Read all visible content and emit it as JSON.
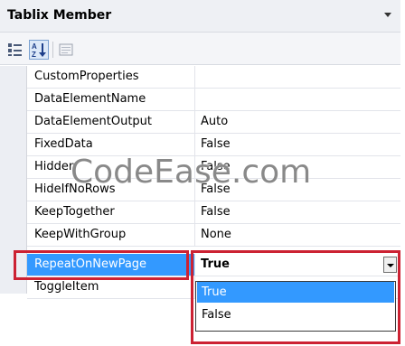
{
  "header": {
    "title": "Tablix Member"
  },
  "toolbar": {
    "buttons": [
      {
        "icon": "categorized-icon"
      },
      {
        "icon": "alphabetical-sort-icon",
        "label": "A Z"
      },
      {
        "icon": "property-pages-icon"
      }
    ]
  },
  "properties": [
    {
      "name": "CustomProperties",
      "value": ""
    },
    {
      "name": "DataElementName",
      "value": ""
    },
    {
      "name": "DataElementOutput",
      "value": "Auto"
    },
    {
      "name": "FixedData",
      "value": "False"
    },
    {
      "name": "Hidden",
      "value": "False"
    },
    {
      "name": "HideIfNoRows",
      "value": "False"
    },
    {
      "name": "KeepTogether",
      "value": "False"
    },
    {
      "name": "KeepWithGroup",
      "value": "None"
    },
    {
      "name": "RepeatOnNewPage",
      "value": "True"
    },
    {
      "name": "ToggleItem",
      "value": ""
    }
  ],
  "dropdown": {
    "options": [
      "True",
      "False"
    ],
    "highlighted": "True"
  },
  "watermark": "CodeEase.com",
  "colors": {
    "selection": "#3399ff",
    "highlight_box": "#cc2233"
  }
}
